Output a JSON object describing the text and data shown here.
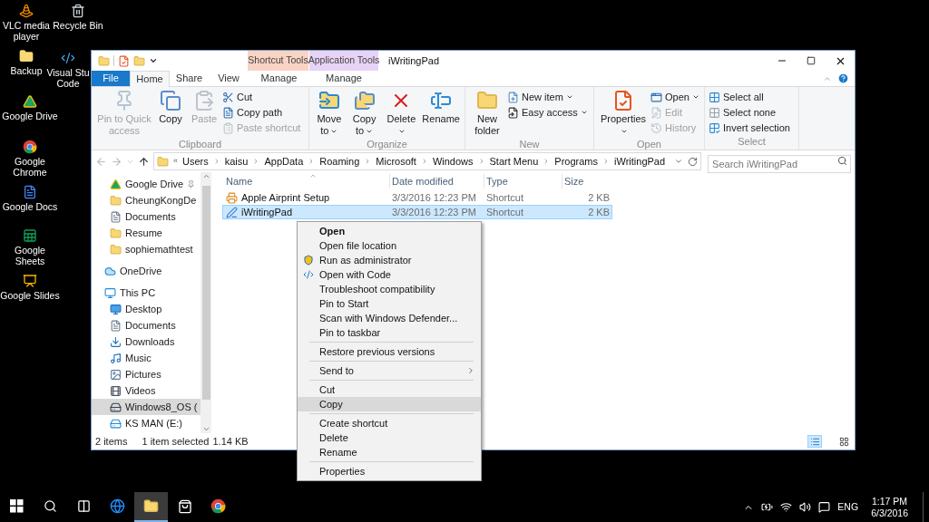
{
  "desktop_icons": [
    {
      "label": "VLC media player"
    },
    {
      "label": "Recycle Bin"
    },
    {
      "label": "Backup"
    },
    {
      "label": "Visual Stu Code"
    },
    {
      "label": "Google Drive"
    },
    {
      "label": "Google Chrome"
    },
    {
      "label": "Google Docs"
    },
    {
      "label": "Google Sheets"
    },
    {
      "label": "Google Slides"
    }
  ],
  "window": {
    "title": "iWritingPad",
    "context_tabs": [
      {
        "label": "Shortcut Tools",
        "color": "#f9d3c3"
      },
      {
        "label": "Application Tools",
        "color": "#e6d3f6"
      }
    ],
    "ribbon_tabs": [
      {
        "label": "File",
        "kind": "file",
        "selected": false
      },
      {
        "label": "Home",
        "kind": "tab",
        "selected": true
      },
      {
        "label": "Share",
        "kind": "tab",
        "selected": false
      },
      {
        "label": "View",
        "kind": "tab",
        "selected": false
      },
      {
        "label": "Manage",
        "kind": "context",
        "selected": false
      },
      {
        "label": "Manage",
        "kind": "context",
        "selected": false
      }
    ],
    "ribbon_groups": [
      {
        "label": "Clipboard",
        "items": [
          {
            "label": "Pin to Quick access",
            "kind": "large",
            "disabled": true,
            "dropdown": false
          },
          {
            "label": "Copy",
            "kind": "large",
            "disabled": false,
            "dropdown": false
          },
          {
            "label": "Paste",
            "kind": "large",
            "disabled": true,
            "dropdown": false
          },
          {
            "label": "Cut",
            "kind": "small",
            "disabled": false,
            "dropdown": false
          },
          {
            "label": "Copy path",
            "kind": "small",
            "disabled": false,
            "dropdown": false
          },
          {
            "label": "Paste shortcut",
            "kind": "small",
            "disabled": true,
            "dropdown": false
          }
        ]
      },
      {
        "label": "Organize",
        "items": [
          {
            "label": "Move to",
            "kind": "large",
            "disabled": false,
            "dropdown": true
          },
          {
            "label": "Copy to",
            "kind": "large",
            "disabled": false,
            "dropdown": true
          },
          {
            "label": "Delete",
            "kind": "large",
            "disabled": false,
            "dropdown": true
          },
          {
            "label": "Rename",
            "kind": "large",
            "disabled": false,
            "dropdown": false
          }
        ]
      },
      {
        "label": "New",
        "items": [
          {
            "label": "New folder",
            "kind": "large",
            "disabled": false,
            "dropdown": false
          },
          {
            "label": "New item",
            "kind": "small",
            "disabled": false,
            "dropdown": true
          },
          {
            "label": "Easy access",
            "kind": "small",
            "disabled": false,
            "dropdown": true
          }
        ]
      },
      {
        "label": "Open",
        "items": [
          {
            "label": "Properties",
            "kind": "large",
            "disabled": false,
            "dropdown": true
          },
          {
            "label": "Open",
            "kind": "small",
            "disabled": false,
            "dropdown": true
          },
          {
            "label": "Edit",
            "kind": "small",
            "disabled": true,
            "dropdown": false
          },
          {
            "label": "History",
            "kind": "small",
            "disabled": true,
            "dropdown": false
          }
        ]
      },
      {
        "label": "Select",
        "items": [
          {
            "label": "Select all",
            "kind": "small",
            "disabled": false,
            "dropdown": false
          },
          {
            "label": "Select none",
            "kind": "small",
            "disabled": false,
            "dropdown": false
          },
          {
            "label": "Invert selection",
            "kind": "small",
            "disabled": false,
            "dropdown": false
          }
        ]
      }
    ],
    "address": {
      "overflow": "«",
      "crumbs": [
        "Users",
        "kaisu",
        "AppData",
        "Roaming",
        "Microsoft",
        "Windows",
        "Start Menu",
        "Programs",
        "iWritingPad"
      ]
    },
    "search": {
      "placeholder": "Search iWritingPad"
    },
    "nav": {
      "quick_items": [
        {
          "label": "Google Drive",
          "pinned": true,
          "selected": false
        },
        {
          "label": "CheungKongDe",
          "pinned": false,
          "selected": false
        },
        {
          "label": "Documents",
          "pinned": false,
          "selected": false
        },
        {
          "label": "Resume",
          "pinned": false,
          "selected": false
        },
        {
          "label": "sophiemathtest",
          "pinned": false,
          "selected": false
        }
      ],
      "items": [
        {
          "label": "OneDrive",
          "selected": false
        },
        {
          "label": "This PC",
          "selected": false,
          "children": [
            {
              "label": "Desktop",
              "selected": false
            },
            {
              "label": "Documents",
              "selected": false
            },
            {
              "label": "Downloads",
              "selected": false
            },
            {
              "label": "Music",
              "selected": false
            },
            {
              "label": "Pictures",
              "selected": false
            },
            {
              "label": "Videos",
              "selected": false
            },
            {
              "label": "Windows8_OS (",
              "selected": true
            },
            {
              "label": "KS MAN (E:)",
              "selected": false
            }
          ]
        }
      ]
    },
    "files": {
      "columns": [
        "Name",
        "Date modified",
        "Type",
        "Size"
      ],
      "rows": [
        {
          "name": "Apple Airprint Setup",
          "date": "3/3/2016 12:23 PM",
          "type": "Shortcut",
          "size": "2 KB",
          "selected": false
        },
        {
          "name": "iWritingPad",
          "date": "3/3/2016 12:23 PM",
          "type": "Shortcut",
          "size": "2 KB",
          "selected": true
        }
      ]
    },
    "status": {
      "count": "2 items",
      "selection": "1 item selected",
      "size": "1.14 KB"
    },
    "view_buttons": [
      {
        "selected": true
      },
      {
        "selected": false
      }
    ]
  },
  "context_menu": {
    "groups": [
      [
        {
          "label": "Open",
          "default": true,
          "selected": false,
          "submenu": false
        },
        {
          "label": "Open file location",
          "default": false,
          "selected": false,
          "submenu": false
        },
        {
          "label": "Run as administrator",
          "default": false,
          "selected": false,
          "submenu": false
        },
        {
          "label": "Open with Code",
          "default": false,
          "selected": false,
          "submenu": false
        },
        {
          "label": "Troubleshoot compatibility",
          "default": false,
          "selected": false,
          "submenu": false
        },
        {
          "label": "Pin to Start",
          "default": false,
          "selected": false,
          "submenu": false
        },
        {
          "label": "Scan with Windows Defender...",
          "default": false,
          "selected": false,
          "submenu": false
        },
        {
          "label": "Pin to taskbar",
          "default": false,
          "selected": false,
          "submenu": false
        }
      ],
      [
        {
          "label": "Restore previous versions",
          "default": false,
          "selected": false,
          "submenu": false
        }
      ],
      [
        {
          "label": "Send to",
          "default": false,
          "selected": false,
          "submenu": true
        }
      ],
      [
        {
          "label": "Cut",
          "default": false,
          "selected": false,
          "submenu": false
        },
        {
          "label": "Copy",
          "default": false,
          "selected": true,
          "submenu": false
        }
      ],
      [
        {
          "label": "Create shortcut",
          "default": false,
          "selected": false,
          "submenu": false
        },
        {
          "label": "Delete",
          "default": false,
          "selected": false,
          "submenu": false
        },
        {
          "label": "Rename",
          "default": false,
          "selected": false,
          "submenu": false
        }
      ],
      [
        {
          "label": "Properties",
          "default": false,
          "selected": false,
          "submenu": false
        }
      ]
    ]
  },
  "taskbar": {
    "apps": [
      {
        "selected": false
      },
      {
        "selected": false
      },
      {
        "selected": false
      },
      {
        "selected": false
      },
      {
        "selected": true
      },
      {
        "selected": false
      },
      {
        "selected": false
      }
    ],
    "language": "ENG",
    "time": "1:17 PM",
    "date": "6/3/2016"
  }
}
